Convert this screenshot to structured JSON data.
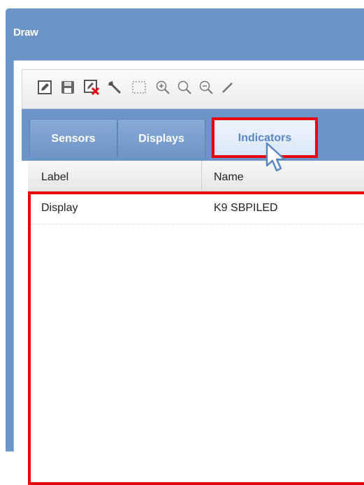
{
  "window": {
    "title": "Draw"
  },
  "toolbar": {
    "buttons": [
      {
        "icon": "edit-icon"
      },
      {
        "icon": "save-icon"
      },
      {
        "icon": "delete-icon"
      },
      {
        "icon": "wrench-icon"
      },
      {
        "icon": "select-rectangle-icon"
      },
      {
        "icon": "zoom-in-icon"
      },
      {
        "icon": "zoom-icon"
      },
      {
        "icon": "zoom-out-icon"
      },
      {
        "icon": "line-icon"
      }
    ]
  },
  "tabs": [
    {
      "label": "Sensors",
      "active": false
    },
    {
      "label": "Displays",
      "active": false
    },
    {
      "label": "Indicators",
      "active": true
    }
  ],
  "grid": {
    "columns": [
      "Label",
      "Name"
    ],
    "rows": [
      {
        "label": "Display",
        "name": "K9 SBPILED"
      }
    ]
  },
  "colors": {
    "window_frame": "#6d94c7",
    "highlight": "#e8000b",
    "active_tab_text": "#5a86c2"
  }
}
